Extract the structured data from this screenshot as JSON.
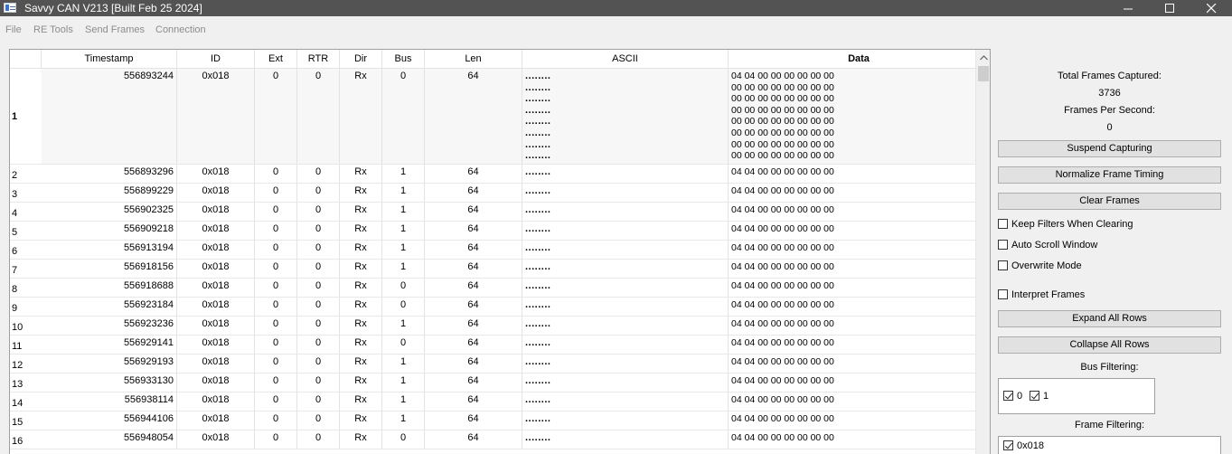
{
  "window": {
    "title": "Savvy CAN V213 [Built Feb 25 2024]"
  },
  "menu": [
    "File",
    "RE Tools",
    "Send Frames",
    "Connection"
  ],
  "table": {
    "columns": [
      "Timestamp",
      "ID",
      "Ext",
      "RTR",
      "Dir",
      "Bus",
      "Len",
      "ASCII",
      "Data"
    ],
    "ascii_short": "........",
    "data_short": "04 04 00 00 00 00 00 00",
    "first_row_ascii": "........\n........\n........\n........\n........\n........\n........\n........",
    "first_row_data": "04 04 00 00 00 00 00 00\n00 00 00 00 00 00 00 00\n00 00 00 00 00 00 00 00\n00 00 00 00 00 00 00 00\n00 00 00 00 00 00 00 00\n00 00 00 00 00 00 00 00\n00 00 00 00 00 00 00 00\n00 00 00 00 00 00 00 00",
    "rows": [
      {
        "num": "1",
        "ts": "556893244",
        "id": "0x018",
        "ext": "0",
        "rtr": "0",
        "dir": "Rx",
        "bus": "0",
        "len": "64"
      },
      {
        "num": "2",
        "ts": "556893296",
        "id": "0x018",
        "ext": "0",
        "rtr": "0",
        "dir": "Rx",
        "bus": "1",
        "len": "64"
      },
      {
        "num": "3",
        "ts": "556899229",
        "id": "0x018",
        "ext": "0",
        "rtr": "0",
        "dir": "Rx",
        "bus": "1",
        "len": "64"
      },
      {
        "num": "4",
        "ts": "556902325",
        "id": "0x018",
        "ext": "0",
        "rtr": "0",
        "dir": "Rx",
        "bus": "1",
        "len": "64"
      },
      {
        "num": "5",
        "ts": "556909218",
        "id": "0x018",
        "ext": "0",
        "rtr": "0",
        "dir": "Rx",
        "bus": "1",
        "len": "64"
      },
      {
        "num": "6",
        "ts": "556913194",
        "id": "0x018",
        "ext": "0",
        "rtr": "0",
        "dir": "Rx",
        "bus": "1",
        "len": "64"
      },
      {
        "num": "7",
        "ts": "556918156",
        "id": "0x018",
        "ext": "0",
        "rtr": "0",
        "dir": "Rx",
        "bus": "1",
        "len": "64"
      },
      {
        "num": "8",
        "ts": "556918688",
        "id": "0x018",
        "ext": "0",
        "rtr": "0",
        "dir": "Rx",
        "bus": "0",
        "len": "64"
      },
      {
        "num": "9",
        "ts": "556923184",
        "id": "0x018",
        "ext": "0",
        "rtr": "0",
        "dir": "Rx",
        "bus": "0",
        "len": "64"
      },
      {
        "num": "10",
        "ts": "556923236",
        "id": "0x018",
        "ext": "0",
        "rtr": "0",
        "dir": "Rx",
        "bus": "1",
        "len": "64"
      },
      {
        "num": "11",
        "ts": "556929141",
        "id": "0x018",
        "ext": "0",
        "rtr": "0",
        "dir": "Rx",
        "bus": "0",
        "len": "64"
      },
      {
        "num": "12",
        "ts": "556929193",
        "id": "0x018",
        "ext": "0",
        "rtr": "0",
        "dir": "Rx",
        "bus": "1",
        "len": "64"
      },
      {
        "num": "13",
        "ts": "556933130",
        "id": "0x018",
        "ext": "0",
        "rtr": "0",
        "dir": "Rx",
        "bus": "1",
        "len": "64"
      },
      {
        "num": "14",
        "ts": "556938114",
        "id": "0x018",
        "ext": "0",
        "rtr": "0",
        "dir": "Rx",
        "bus": "1",
        "len": "64"
      },
      {
        "num": "15",
        "ts": "556944106",
        "id": "0x018",
        "ext": "0",
        "rtr": "0",
        "dir": "Rx",
        "bus": "1",
        "len": "64"
      },
      {
        "num": "16",
        "ts": "556948054",
        "id": "0x018",
        "ext": "0",
        "rtr": "0",
        "dir": "Rx",
        "bus": "0",
        "len": "64"
      }
    ]
  },
  "panel": {
    "total_frames_label": "Total Frames Captured:",
    "total_frames_value": "3736",
    "fps_label": "Frames Per Second:",
    "fps_value": "0",
    "suspend_button": "Suspend Capturing",
    "normalize_button": "Normalize Frame Timing",
    "clear_button": "Clear Frames",
    "keep_filters": {
      "label": "Keep Filters When Clearing",
      "checked": false
    },
    "auto_scroll": {
      "label": "Auto Scroll Window",
      "checked": false
    },
    "overwrite": {
      "label": "Overwrite Mode",
      "checked": false
    },
    "interpret": {
      "label": "Interpret Frames",
      "checked": false
    },
    "expand_button": "Expand All Rows",
    "collapse_button": "Collapse All Rows",
    "bus_filtering_label": "Bus Filtering:",
    "bus_items": [
      {
        "label": "0",
        "checked": true
      },
      {
        "label": "1",
        "checked": true
      }
    ],
    "frame_filtering_label": "Frame Filtering:",
    "frame_items": [
      {
        "label": "0x018",
        "checked": true
      }
    ]
  }
}
